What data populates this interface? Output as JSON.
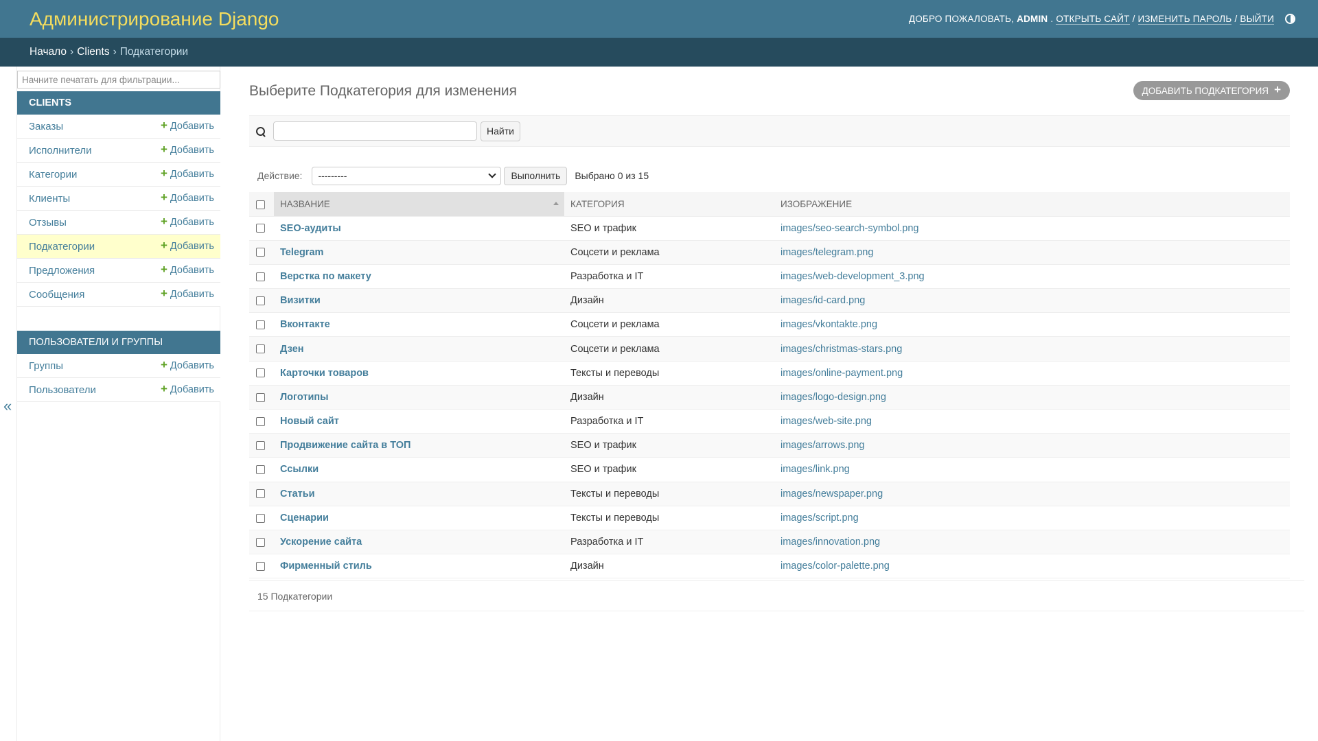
{
  "header": {
    "branding": "Администрирование Django",
    "welcome": "Добро пожаловать,",
    "username": "admin",
    "view_site": "Открыть сайт",
    "change_password": "Изменить пароль",
    "logout": "Выйти"
  },
  "breadcrumbs": {
    "home": "Начало",
    "app": "Clients",
    "current": "Подкатегории"
  },
  "sidebar": {
    "filter_placeholder": "Начните печатать для фильтрации...",
    "add_label": "Добавить",
    "apps": [
      {
        "caption": "Clients",
        "models": [
          "Заказы",
          "Исполнители",
          "Категории",
          "Клиенты",
          "Отзывы",
          "Подкатегории",
          "Предложения",
          "Сообщения"
        ]
      },
      {
        "caption": "Пользователи и группы",
        "models": [
          "Группы",
          "Пользователи"
        ]
      }
    ],
    "toggle": "«"
  },
  "content": {
    "title": "Выберите Подкатегория для изменения",
    "add_button": "Добавить Подкатегория",
    "search_button": "Найти",
    "action_label": "Действие:",
    "action_selected": "---------",
    "action_go": "Выполнить",
    "action_counter": "Выбрано 0 из 15",
    "columns": [
      "Название",
      "Категория",
      "Изображение"
    ],
    "rows": [
      [
        "SEO-аудиты",
        "SEO и трафик",
        "images/seo-search-symbol.png"
      ],
      [
        "Telegram",
        "Соцсети и реклама",
        "images/telegram.png"
      ],
      [
        "Верстка по макету",
        "Разработка и IT",
        "images/web-development_3.png"
      ],
      [
        "Визитки",
        "Дизайн",
        "images/id-card.png"
      ],
      [
        "Вконтакте",
        "Соцсети и реклама",
        "images/vkontakte.png"
      ],
      [
        "Дзен",
        "Соцсети и реклама",
        "images/christmas-stars.png"
      ],
      [
        "Карточки товаров",
        "Тексты и переводы",
        "images/online-payment.png"
      ],
      [
        "Логотипы",
        "Дизайн",
        "images/logo-design.png"
      ],
      [
        "Новый сайт",
        "Разработка и IT",
        "images/web-site.png"
      ],
      [
        "Продвижение сайта в ТОП",
        "SEO и трафик",
        "images/arrows.png"
      ],
      [
        "Ссылки",
        "SEO и трафик",
        "images/link.png"
      ],
      [
        "Статьи",
        "Тексты и переводы",
        "images/newspaper.png"
      ],
      [
        "Сценарии",
        "Тексты и переводы",
        "images/script.png"
      ],
      [
        "Ускорение сайта",
        "Разработка и IT",
        "images/innovation.png"
      ],
      [
        "Фирменный стиль",
        "Дизайн",
        "images/color-palette.png"
      ]
    ],
    "paginator": "15 Подкатегории"
  }
}
